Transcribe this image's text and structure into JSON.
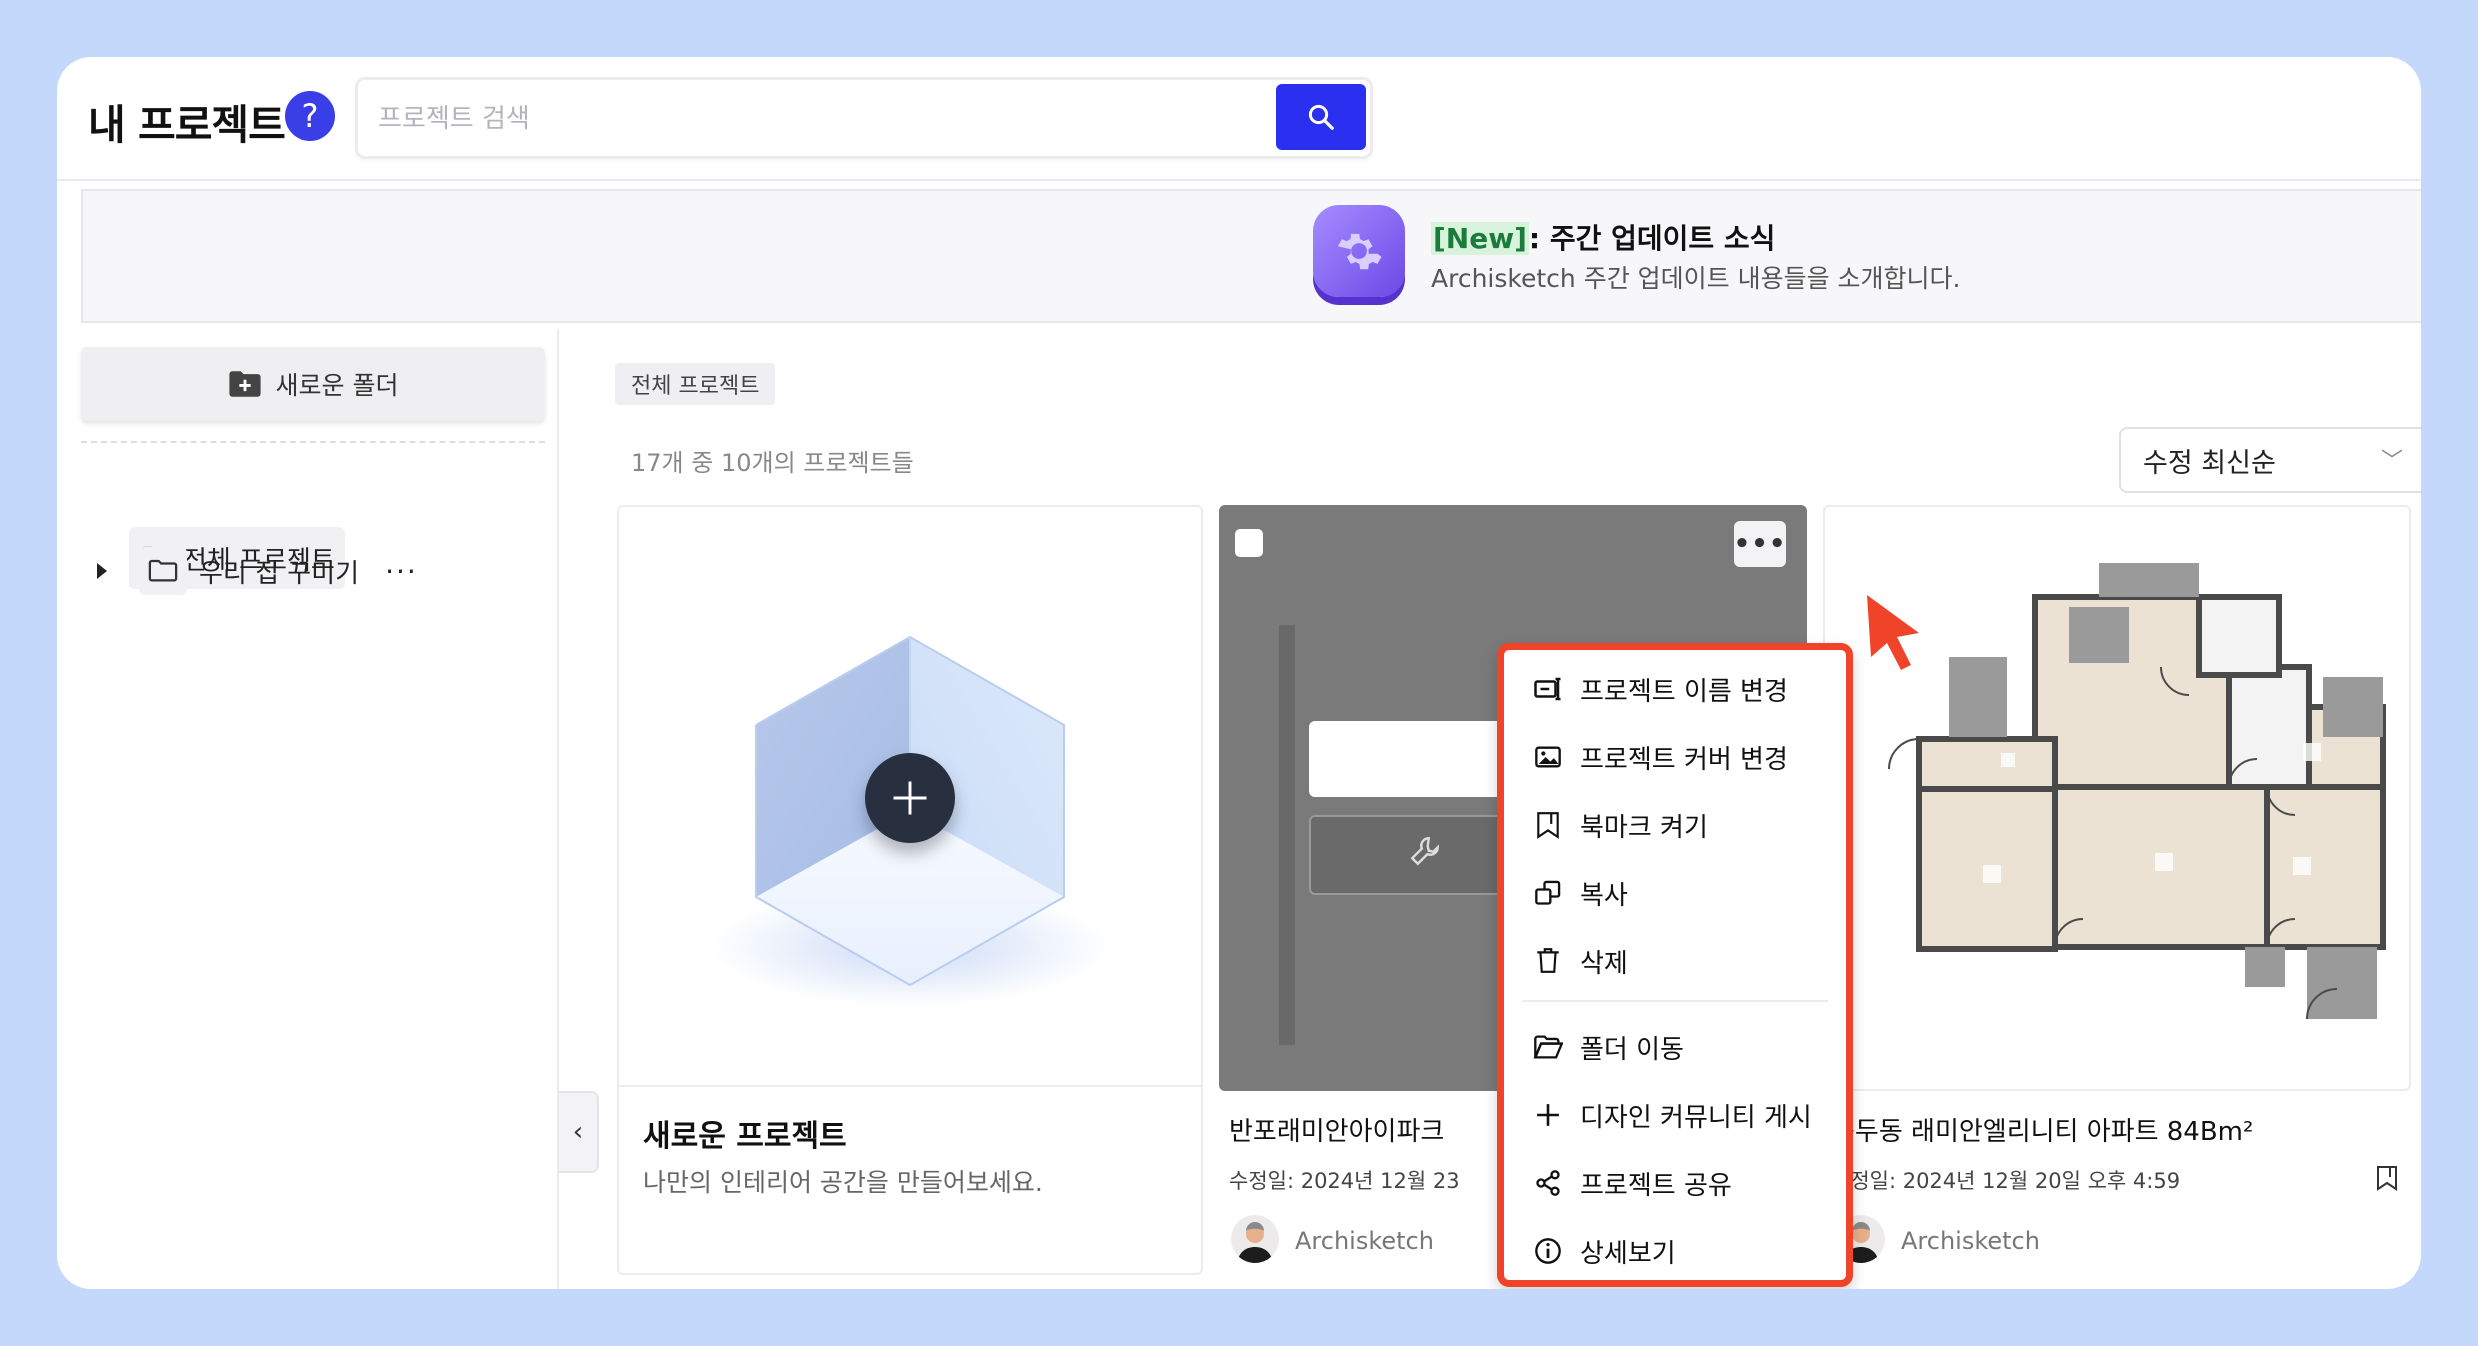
{
  "header": {
    "title": "내 프로젝트",
    "help_symbol": "?",
    "search_placeholder": "프로젝트 검색"
  },
  "banner": {
    "tag": "[New]",
    "title_rest": ": 주간 업데이트 소식",
    "description": "Archisketch 주간 업데이트 내용들을 소개합니다."
  },
  "sidebar": {
    "new_folder_label": "새로운 폴더",
    "folders": [
      {
        "label": "전체 프로젝트"
      },
      {
        "label": "우리 집 꾸미기",
        "more": "···"
      }
    ],
    "collapse_symbol": "‹"
  },
  "main": {
    "breadcrumb": "전체 프로젝트",
    "count_text": "17개 중 10개의 프로젝트들",
    "sort_selected": "수정 최신순",
    "new_card": {
      "title": "새로운 프로젝트",
      "subtitle": "나만의 인테리어 공간을 만들어보세요."
    },
    "cards": [
      {
        "title": "반포래미안아이파크",
        "date": "수정일: 2024년 12월 23",
        "author": "Archisketch",
        "more_symbol": "•••"
      },
      {
        "title": "용두동 래미안엘리니티 아파트 84Bm²",
        "date": "수정일: 2024년 12월 20일 오후 4:59",
        "author": "Archisketch"
      }
    ]
  },
  "context_menu": {
    "items": [
      {
        "label": "프로젝트 이름 변경",
        "icon": "rename-icon"
      },
      {
        "label": "프로젝트 커버 변경",
        "icon": "image-icon"
      },
      {
        "label": "북마크 켜기",
        "icon": "bookmark-icon"
      },
      {
        "label": "복사",
        "icon": "copy-icon"
      },
      {
        "label": "삭제",
        "icon": "trash-icon"
      },
      {
        "label": "폴더 이동",
        "icon": "folder-open-icon"
      },
      {
        "label": "디자인 커뮤니티 게시",
        "icon": "plus-icon"
      },
      {
        "label": "프로젝트 공유",
        "icon": "share-icon"
      },
      {
        "label": "상세보기",
        "icon": "info-icon"
      }
    ]
  },
  "colors": {
    "accent": "#2b2ff0",
    "highlight_border": "#f0442a",
    "background": "#c3d8fb"
  }
}
